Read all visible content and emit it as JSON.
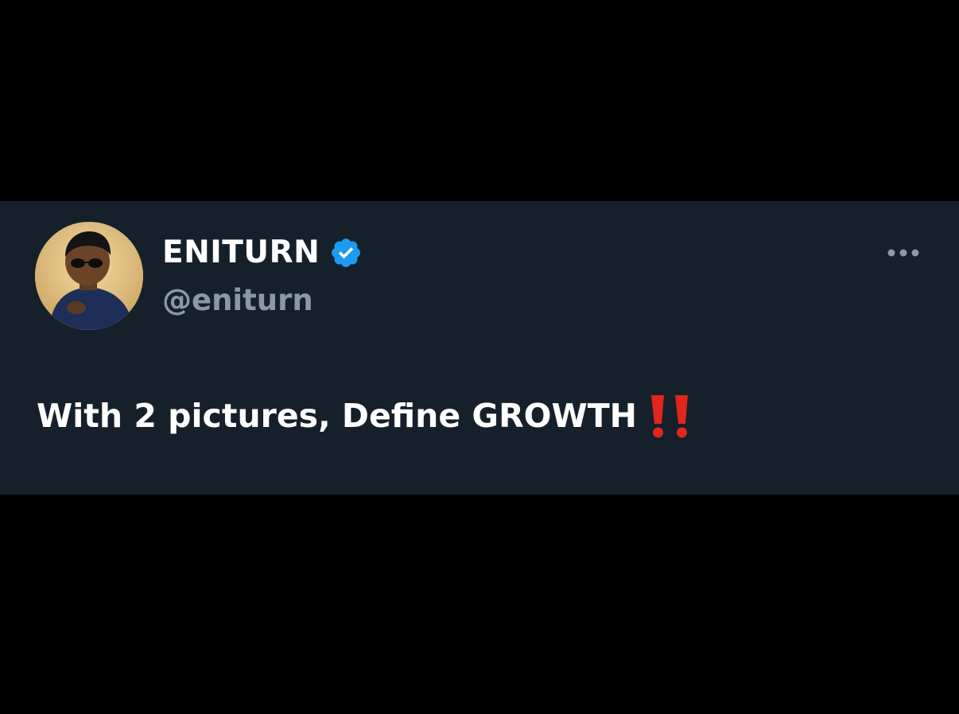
{
  "tweet": {
    "author": {
      "display_name": "ENITURN",
      "handle": "@eniturn",
      "verified": true,
      "verified_icon": "verified-badge-icon",
      "avatar": "user-avatar-photo"
    },
    "text": "With 2 pictures, Define GROWTH",
    "emoji": "double-exclamation-icon",
    "more_icon": "more-options-icon"
  },
  "colors": {
    "page_background": "#000000",
    "card_background": "#15202b",
    "primary_text": "#ffffff",
    "secondary_text": "#8b98a5",
    "verified_blue": "#1d9bf0",
    "emoji_red": "#e0261d"
  }
}
